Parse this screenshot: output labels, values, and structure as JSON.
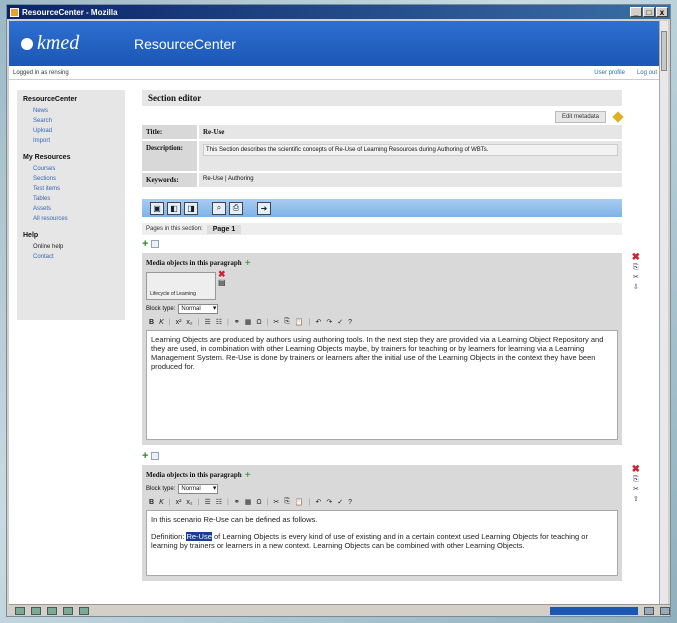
{
  "window": {
    "title": "ResourceCenter - Mozilla",
    "controls": [
      "_",
      "□",
      "x"
    ]
  },
  "header": {
    "logo": "kmed",
    "app_title": "ResourceCenter"
  },
  "status": {
    "logged_in": "Logged in as rensing",
    "user_profile": "User profile",
    "logout": "Log out"
  },
  "sidebar": {
    "sections": [
      {
        "title": "ResourceCenter",
        "items": [
          "News",
          "Search",
          "Upload",
          "Import"
        ]
      },
      {
        "title": "My Resources",
        "items": [
          "Courses",
          "Sections",
          "Test items",
          "Tables",
          "Assets",
          "All resources"
        ]
      },
      {
        "title": "Help",
        "items": [
          "Online help",
          "Contact"
        ]
      }
    ]
  },
  "editor": {
    "section_title": "Section editor",
    "edit_metadata": "Edit metadata",
    "fields": {
      "title_label": "Title:",
      "title_value": "Re-Use",
      "description_label": "Description:",
      "description_value": "This Section describes the scientific concepts of Re-Use of Learning Resources during Authoring of WBTs.",
      "keywords_label": "Keywords:",
      "keywords_value": "Re-Use | Authoring"
    },
    "pages_label": "Pages in this section:",
    "current_page": "Page 1"
  },
  "paragraphs": [
    {
      "media_label": "Media objects in this paragraph",
      "media_caption": "Lifecycle of Learning",
      "block_type_label": "Block type:",
      "block_type": "Normal",
      "text": "Learning Objects are produced by authors using authoring tools. In the next step they are provided via a Learning Object Repository and they are used, in combination with other Learning Objects maybe, by trainers for teaching or by learners for learning via a Learning Management System. Re-Use is done by trainers or learners after the initial use of the Learning Objects in the context they have been produced for."
    },
    {
      "media_label": "Media objects in this paragraph",
      "block_type_label": "Block type:",
      "block_type": "Normal",
      "line1": "In this scenario Re-Use can be defined as follows.",
      "def_prefix": "Definition:",
      "def_highlight": "Re-Use",
      "def_rest": " of Learning Objects is every kind of use of existing and in a certain context used Learning Objects for teaching or learning by trainers or learners in a new context. Learning Objects can be combined with other Learning Objects."
    }
  ],
  "editor_toolbar": {
    "bold": "B",
    "italic": "K",
    "sup": "x²",
    "sub": "x₂",
    "ul": "☰",
    "ol": "☷",
    "link": "⚭",
    "table": "▦",
    "omega": "Ω",
    "cut": "✂",
    "copy": "⎘",
    "paste": "📋",
    "undo": "↶",
    "redo": "↷",
    "spell": "✓",
    "help": "?"
  },
  "main_toolbar_icons": [
    "save-icon",
    "save-close-icon",
    "close-icon",
    "preview-icon",
    "print-icon",
    "export-icon"
  ]
}
